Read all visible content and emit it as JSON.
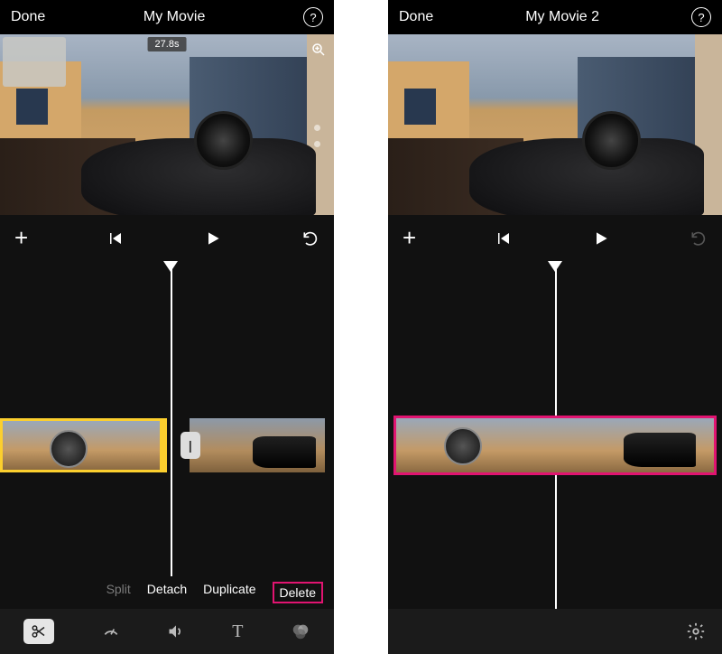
{
  "left": {
    "done": "Done",
    "title": "My Movie",
    "time_badge": "27.8s",
    "playhead_pct": 51,
    "split_handle_pct": 54,
    "actions": {
      "split": "Split",
      "detach": "Detach",
      "duplicate": "Duplicate",
      "delete": "Delete"
    }
  },
  "right": {
    "done": "Done",
    "title": "My Movie 2",
    "playhead_pct": 50
  },
  "icons": {
    "help": "?",
    "plus": "+",
    "split_handle": "|"
  }
}
